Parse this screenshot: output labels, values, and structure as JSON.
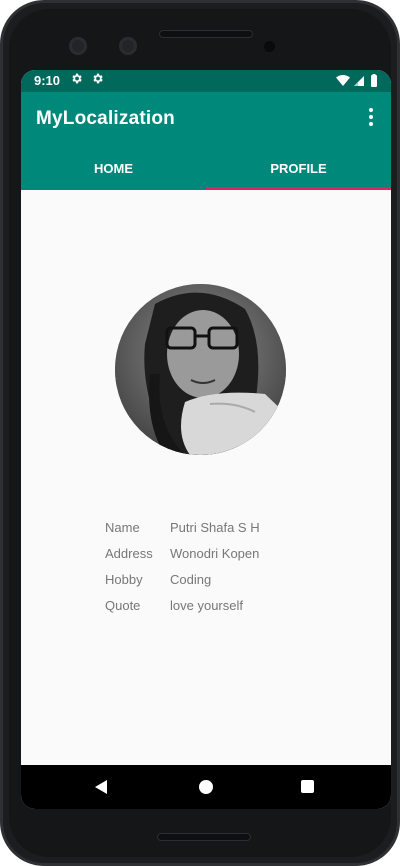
{
  "status_bar": {
    "time": "9:10",
    "icons": [
      "gear-icon",
      "gear-icon",
      "wifi-icon",
      "cellular-signal-icon",
      "battery-icon"
    ],
    "background_color": "#00695c"
  },
  "app_bar": {
    "title": "MyLocalization",
    "background_color": "#00897b",
    "menu_icon": "more-vert-icon"
  },
  "tabs": [
    {
      "label": "HOME",
      "selected": false
    },
    {
      "label": "PROFILE",
      "selected": true
    }
  ],
  "tab_indicator_color": "#e91e63",
  "profile": {
    "photo": "profile-photo",
    "fields": [
      {
        "label": "Name",
        "value": "Putri Shafa S H"
      },
      {
        "label": "Address",
        "value": "Wonodri Kopen"
      },
      {
        "label": "Hobby",
        "value": "Coding"
      },
      {
        "label": "Quote",
        "value": "love yourself"
      }
    ]
  },
  "nav_bar": {
    "buttons": [
      "back-icon",
      "home-icon",
      "recents-icon"
    ]
  }
}
